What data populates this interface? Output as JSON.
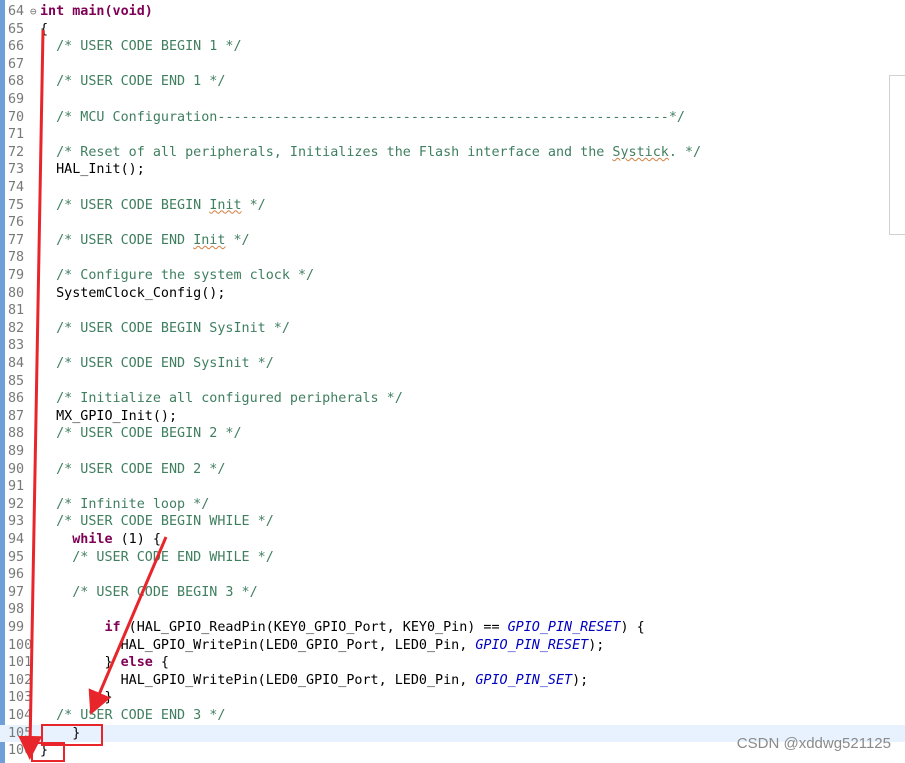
{
  "editor": {
    "lines": [
      {
        "n": "64",
        "fold": "⊖",
        "tokens": [
          {
            "t": "kw",
            "v": "int"
          },
          {
            "t": "plain",
            "v": " "
          },
          {
            "t": "kwplain",
            "v": "main(void)"
          }
        ]
      },
      {
        "n": "65",
        "tokens": [
          {
            "t": "plain",
            "v": "{"
          }
        ]
      },
      {
        "n": "66",
        "tokens": [
          {
            "t": "comment",
            "v": "  /* USER CODE BEGIN 1 */"
          }
        ]
      },
      {
        "n": "67",
        "tokens": []
      },
      {
        "n": "68",
        "tokens": [
          {
            "t": "comment",
            "v": "  /* USER CODE END 1 */"
          }
        ]
      },
      {
        "n": "69",
        "tokens": []
      },
      {
        "n": "70",
        "tokens": [
          {
            "t": "comment",
            "v": "  /* MCU Configuration--------------------------------------------------------*/"
          }
        ]
      },
      {
        "n": "71",
        "tokens": []
      },
      {
        "n": "72",
        "tokens": [
          {
            "t": "comment",
            "v": "  /* Reset of all peripherals, Initializes the Flash interface and the "
          },
          {
            "t": "comment-sq",
            "v": "Systick"
          },
          {
            "t": "comment",
            "v": ". */"
          }
        ]
      },
      {
        "n": "73",
        "tokens": [
          {
            "t": "plain",
            "v": "  HAL_Init();"
          }
        ]
      },
      {
        "n": "74",
        "tokens": []
      },
      {
        "n": "75",
        "tokens": [
          {
            "t": "comment",
            "v": "  /* USER CODE BEGIN "
          },
          {
            "t": "comment-sq",
            "v": "Init"
          },
          {
            "t": "comment",
            "v": " */"
          }
        ]
      },
      {
        "n": "76",
        "tokens": []
      },
      {
        "n": "77",
        "tokens": [
          {
            "t": "comment",
            "v": "  /* USER CODE END "
          },
          {
            "t": "comment-sq",
            "v": "Init"
          },
          {
            "t": "comment",
            "v": " */"
          }
        ]
      },
      {
        "n": "78",
        "tokens": []
      },
      {
        "n": "79",
        "tokens": [
          {
            "t": "comment",
            "v": "  /* Configure the system clock */"
          }
        ]
      },
      {
        "n": "80",
        "tokens": [
          {
            "t": "plain",
            "v": "  SystemClock_Config();"
          }
        ]
      },
      {
        "n": "81",
        "tokens": []
      },
      {
        "n": "82",
        "tokens": [
          {
            "t": "comment",
            "v": "  /* USER CODE BEGIN SysInit */"
          }
        ]
      },
      {
        "n": "83",
        "tokens": []
      },
      {
        "n": "84",
        "tokens": [
          {
            "t": "comment",
            "v": "  /* USER CODE END SysInit */"
          }
        ]
      },
      {
        "n": "85",
        "tokens": []
      },
      {
        "n": "86",
        "tokens": [
          {
            "t": "comment",
            "v": "  /* Initialize all configured peripherals */"
          }
        ]
      },
      {
        "n": "87",
        "tokens": [
          {
            "t": "plain",
            "v": "  MX_GPIO_Init();"
          }
        ]
      },
      {
        "n": "88",
        "tokens": [
          {
            "t": "comment",
            "v": "  /* USER CODE BEGIN 2 */"
          }
        ]
      },
      {
        "n": "89",
        "tokens": []
      },
      {
        "n": "90",
        "tokens": [
          {
            "t": "comment",
            "v": "  /* USER CODE END 2 */"
          }
        ]
      },
      {
        "n": "91",
        "tokens": []
      },
      {
        "n": "92",
        "tokens": [
          {
            "t": "comment",
            "v": "  /* Infinite loop */"
          }
        ]
      },
      {
        "n": "93",
        "tokens": [
          {
            "t": "comment",
            "v": "  /* USER CODE BEGIN WHILE */"
          }
        ]
      },
      {
        "n": "94",
        "tokens": [
          {
            "t": "plain",
            "v": "    "
          },
          {
            "t": "kw",
            "v": "while"
          },
          {
            "t": "plain",
            "v": " (1) {"
          }
        ]
      },
      {
        "n": "95",
        "tokens": [
          {
            "t": "comment",
            "v": "    /* USER CODE END WHILE */"
          }
        ]
      },
      {
        "n": "96",
        "tokens": []
      },
      {
        "n": "97",
        "tokens": [
          {
            "t": "comment",
            "v": "    /* USER CODE BEGIN 3 */"
          }
        ]
      },
      {
        "n": "98",
        "tokens": []
      },
      {
        "n": "99",
        "tokens": [
          {
            "t": "plain",
            "v": "        "
          },
          {
            "t": "kw",
            "v": "if"
          },
          {
            "t": "plain",
            "v": " (HAL_GPIO_ReadPin(KEY0_GPIO_Port, KEY0_Pin) == "
          },
          {
            "t": "const",
            "v": "GPIO_PIN_RESET"
          },
          {
            "t": "plain",
            "v": ") {"
          }
        ]
      },
      {
        "n": "100",
        "tokens": [
          {
            "t": "plain",
            "v": "          HAL_GPIO_WritePin(LED0_GPIO_Port, LED0_Pin, "
          },
          {
            "t": "const",
            "v": "GPIO_PIN_RESET"
          },
          {
            "t": "plain",
            "v": ");"
          }
        ]
      },
      {
        "n": "101",
        "tokens": [
          {
            "t": "plain",
            "v": "        } "
          },
          {
            "t": "kw",
            "v": "else"
          },
          {
            "t": "plain",
            "v": " {"
          }
        ]
      },
      {
        "n": "102",
        "tokens": [
          {
            "t": "plain",
            "v": "          HAL_GPIO_WritePin(LED0_GPIO_Port, LED0_Pin, "
          },
          {
            "t": "const",
            "v": "GPIO_PIN_SET"
          },
          {
            "t": "plain",
            "v": ");"
          }
        ]
      },
      {
        "n": "103",
        "tokens": [
          {
            "t": "plain",
            "v": "        }"
          }
        ]
      },
      {
        "n": "104",
        "tokens": [
          {
            "t": "comment",
            "v": "  /* USER CODE END 3 */"
          }
        ]
      },
      {
        "n": "105",
        "current": true,
        "tokens": [
          {
            "t": "plain",
            "v": "    }"
          }
        ]
      },
      {
        "n": "106",
        "tokens": [
          {
            "t": "plain",
            "v": "}"
          }
        ]
      }
    ]
  },
  "colors": {
    "comment": "#3f7f5f",
    "keyword": "#7f0055",
    "constant": "#0000c0",
    "annotation": "#e8252a",
    "current_line": "#e8f2fe"
  },
  "watermark": "CSDN @xddwg521125"
}
